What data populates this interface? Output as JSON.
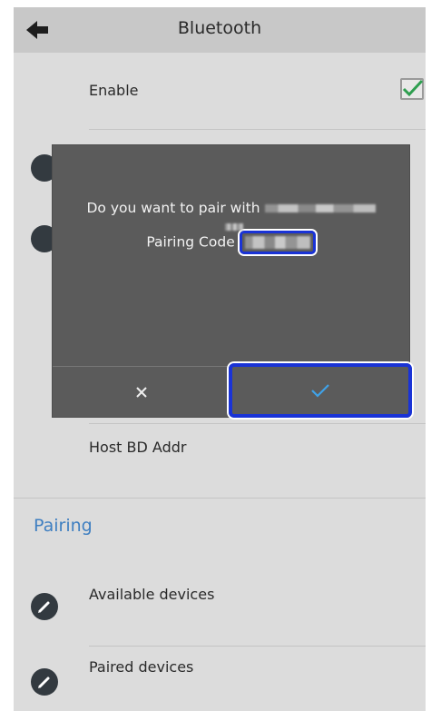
{
  "header": {
    "title": "Bluetooth",
    "back_icon": "arrow-left-icon"
  },
  "settings": {
    "enable_label": "Enable",
    "enable_checked": true,
    "host_bd_addr_label": "Host BD Addr"
  },
  "pairing": {
    "section_title": "Pairing",
    "items": [
      {
        "label": "Available devices",
        "icon": "pencil-icon"
      },
      {
        "label": "Paired devices",
        "icon": "pencil-icon"
      }
    ]
  },
  "dialog": {
    "message_prefix": "Do you want to pair with",
    "code_label": "Pairing Code",
    "cancel_icon": "close-icon",
    "confirm_icon": "check-icon"
  },
  "colors": {
    "accent": "#3f7fc1",
    "check_green": "#2e9e4f",
    "highlight_blue": "#1a33d6",
    "dialog_bg": "#5b5b5b"
  }
}
